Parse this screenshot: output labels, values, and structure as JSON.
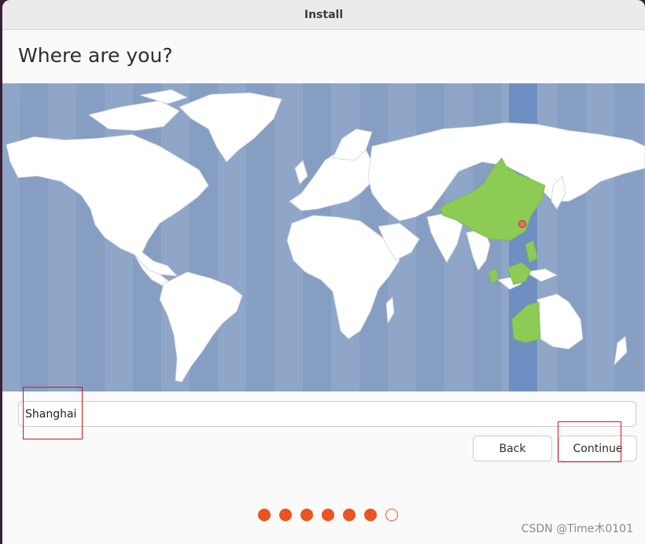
{
  "window": {
    "title": "Install"
  },
  "page": {
    "heading": "Where are you?"
  },
  "map": {
    "selected_timezone_highlight_color": "#8ccc55",
    "ocean_color": "#8fa6c8",
    "land_color": "#ffffff",
    "selected_band_color": "#6f8fc2",
    "marker_color": "#ee6b6b"
  },
  "timezone_field": {
    "value": "Shanghai"
  },
  "buttons": {
    "back": "Back",
    "continue": "Continue"
  },
  "progress": {
    "total_steps": 7,
    "completed_steps": 6,
    "accent_color": "#e95420"
  },
  "watermark": {
    "text": "CSDN @Time木0101"
  }
}
